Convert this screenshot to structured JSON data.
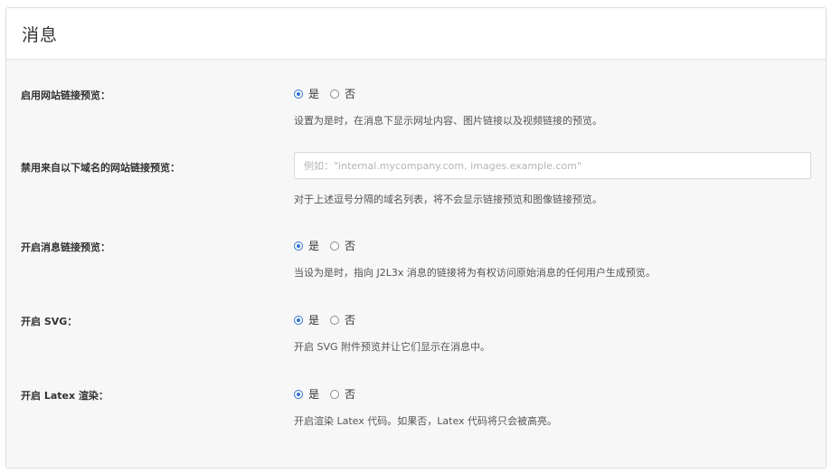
{
  "panel": {
    "title": "消息"
  },
  "radio_options": {
    "yes": "是",
    "no": "否"
  },
  "settings": [
    {
      "label": "启用网站链接预览：",
      "type": "radio",
      "selected": "yes",
      "help": "设置为是时，在消息下显示网址内容、图片链接以及视频链接的预览。"
    },
    {
      "label": "禁用来自以下域名的网站链接预览：",
      "type": "text",
      "value": "",
      "placeholder": "例如：\"internal.mycompany.com, images.example.com\"",
      "help": "对于上述逗号分隔的域名列表，将不会显示链接预览和图像链接预览。"
    },
    {
      "label": "开启消息链接预览：",
      "type": "radio",
      "selected": "yes",
      "help": "当设为是时，指向 J2L3x 消息的链接将为有权访问原始消息的任何用户生成预览。"
    },
    {
      "label": "开启 SVG：",
      "type": "radio",
      "selected": "yes",
      "help": "开启 SVG 附件预览并让它们显示在消息中。"
    },
    {
      "label": "开启 Latex 渲染：",
      "type": "radio",
      "selected": "yes",
      "help": "开启渲染 Latex 代码。如果否，Latex 代码将只会被高亮。"
    }
  ],
  "colors": {
    "accent": "#2f74d0",
    "panel_background": "#f7f7f7",
    "header_background": "#ffffff",
    "border": "#dcdcdc"
  }
}
